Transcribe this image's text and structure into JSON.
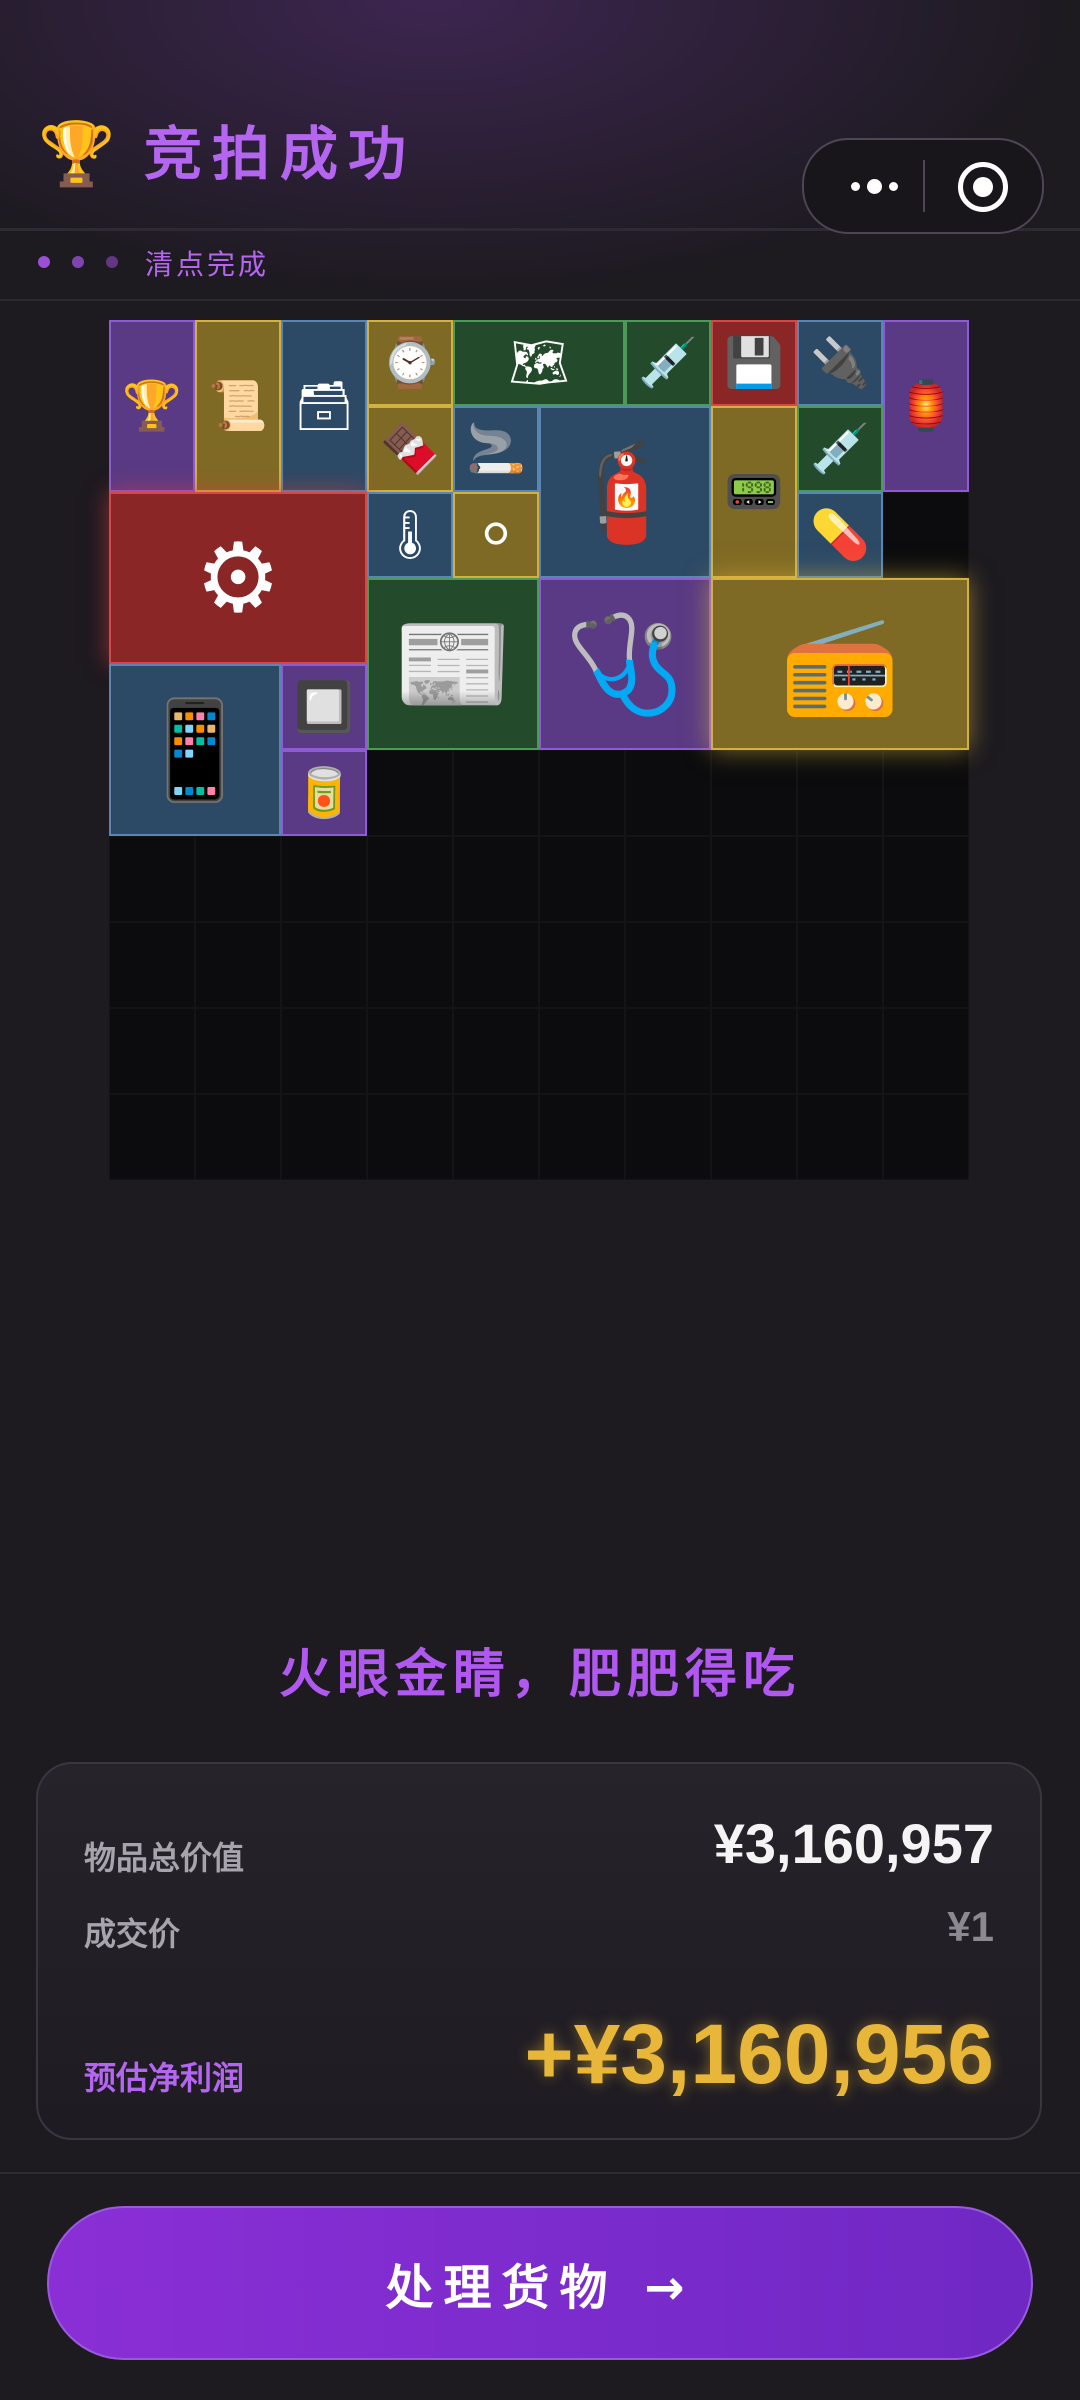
{
  "header": {
    "icon": "trophy-icon",
    "title": "竞拍成功",
    "more_icon": "more-dots-icon",
    "close_icon": "target-circle-icon"
  },
  "status": {
    "text": "清点完成"
  },
  "inventory": {
    "rarity_colors": {
      "purple": "#8e5bd4",
      "gold": "#d3b141",
      "blue": "#5a86b4",
      "green": "#4b9a57",
      "red": "#d64747"
    },
    "items": [
      {
        "name": "torch-trophy-icon",
        "rarity": "purple"
      },
      {
        "name": "documents-icon",
        "rarity": "gold"
      },
      {
        "name": "ammo-box-icon",
        "rarity": "blue"
      },
      {
        "name": "pocket-watch-icon",
        "rarity": "gold"
      },
      {
        "name": "map-icon",
        "rarity": "green"
      },
      {
        "name": "syringe-icon",
        "rarity": "green"
      },
      {
        "name": "usb-drive-icon",
        "rarity": "red"
      },
      {
        "name": "power-adapter-icon",
        "rarity": "blue"
      },
      {
        "name": "lantern-icon",
        "rarity": "purple"
      },
      {
        "name": "chocolate-icon",
        "rarity": "gold"
      },
      {
        "name": "cigarette-box-icon",
        "rarity": "blue"
      },
      {
        "name": "gas-cylinder-icon",
        "rarity": "blue"
      },
      {
        "name": "walkie-talkie-icon",
        "rarity": "gold"
      },
      {
        "name": "syringe-icon",
        "rarity": "green"
      },
      {
        "name": "generator-icon",
        "rarity": "red"
      },
      {
        "name": "thermometer-gun-icon",
        "rarity": "blue"
      },
      {
        "name": "filter-icon",
        "rarity": "gold"
      },
      {
        "name": "pill-bottle-icon",
        "rarity": "blue"
      },
      {
        "name": "newspaper-icon",
        "rarity": "green"
      },
      {
        "name": "blood-pressure-monitor-icon",
        "rarity": "purple"
      },
      {
        "name": "radio-station-icon",
        "rarity": "gold"
      },
      {
        "name": "tablet-icon",
        "rarity": "blue"
      },
      {
        "name": "circuit-board-icon",
        "rarity": "purple"
      },
      {
        "name": "drink-can-icon",
        "rarity": "purple"
      }
    ]
  },
  "slogan": "火眼金睛，肥肥得吃",
  "summary": {
    "total_label": "物品总价值",
    "total_value": "¥3,160,957",
    "deal_label": "成交价",
    "deal_value": "¥1",
    "profit_label": "预估净利润",
    "profit_value": "+¥3,160,956"
  },
  "cta": {
    "label": "处理货物 →"
  }
}
